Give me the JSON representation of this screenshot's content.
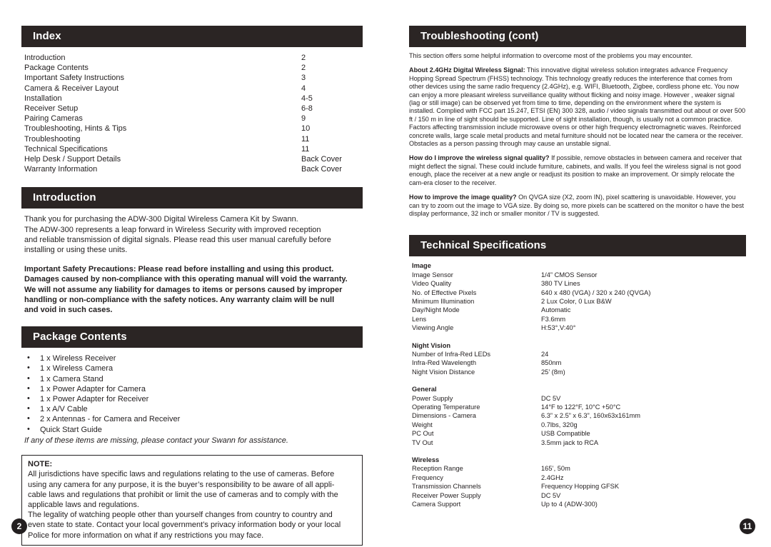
{
  "left_page": {
    "page_number": "2",
    "index": {
      "heading": "Index",
      "rows": [
        {
          "title": "Introduction",
          "page": "2"
        },
        {
          "title": "Package Contents",
          "page": "2"
        },
        {
          "title": "Important Safety Instructions",
          "page": "3"
        },
        {
          "title": "Camera & Receiver Layout",
          "page": "4"
        },
        {
          "title": "Installation",
          "page": "4-5"
        },
        {
          "title": "Receiver Setup",
          "page": "6-8"
        },
        {
          "title": "Pairing Cameras",
          "page": "9"
        },
        {
          "title": "Troubleshooting, Hints & Tips",
          "page": "10"
        },
        {
          "title": "Troubleshooting",
          "page": "11"
        },
        {
          "title": "Technical Specifications",
          "page": "11"
        },
        {
          "title": "Help Desk / Support Details",
          "page": "Back Cover"
        },
        {
          "title": "Warranty Information",
          "page": "Back Cover"
        }
      ]
    },
    "introduction": {
      "heading": "Introduction",
      "line1": "Thank you for purchasing the ADW-300 Digital Wireless Camera Kit by Swann.",
      "line2": "The ADW-300 represents a leap forward in Wireless Security with improved reception",
      "line3": "and reliable transmission of digital signals.  Please read this user manual carefully before",
      "line4": "installing or using these units.",
      "safety1": "Important Safety Precautions: Please read before installing and using this product.",
      "safety2": "Damages caused by non-compliance with this operating manual will void the warranty.",
      "safety3": "We will not assume any liability for damages to items or persons caused by improper",
      "safety4": "handling or non-compliance with the safety notices. Any warranty claim will be null",
      "safety5": "and void in such cases."
    },
    "package_contents": {
      "heading": "Package Contents",
      "items": [
        "1 x Wireless Receiver",
        "1 x Wireless Camera",
        "1 x Camera Stand",
        "1 x Power Adapter for Camera",
        "1 x Power Adapter for Receiver",
        "1 x A/V Cable",
        "2 x Antennas - for Camera and Receiver",
        "Quick Start Guide"
      ],
      "footnote": "If any of these items are missing, please contact your Swann for assistance."
    },
    "note_box": {
      "title": "NOTE:",
      "paragraph1_line1": "All jurisdictions have specific laws and regulations relating to the use of cameras. Before",
      "paragraph1_line2": "using any camera for any purpose, it is the buyer’s responsibility to be aware of all appli-",
      "paragraph1_line3": "cable laws and regulations that prohibit or limit the use of cameras and to comply with the",
      "paragraph1_line4": "applicable laws and regulations.",
      "paragraph2_line1": "The legality of watching people other than yourself changes from country to country and",
      "paragraph2_line2": "even state to state. Contact your local government’s privacy information body or your local",
      "paragraph2_line3": "Police for more information on what if any restrictions you may face."
    }
  },
  "right_page": {
    "page_number": "11",
    "troubleshooting": {
      "heading": "Troubleshooting (cont)",
      "intro": "This section offers some helpful information to overcome most of the problems you may encounter.",
      "p1_label": "About 2.4GHz Digital Wireless Signal:",
      "p1_body": " This innovative digital wireless solution integrates advance Frequency Hopping Spread Spectrum (FHSS) technology. This technology greatly reduces the interference that comes from other devices using the same radio frequency (2.4GHz), e.g. WIFI, Bluetooth, Zigbee, cordless phone etc. You now can enjoy a more pleasant wireless surveillance quality without flicking and noisy image. However , weaker signal (lag or still image) can be observed yet from time to time, depending on the environment where the system is installed. Complied with FCC part 15.247, ETSI (EN) 300 328, audio / video signals transmitted out about or over 500 ft / 150 m in line of sight should be supported. Line of sight installation, though, is usually not a common practice. Factors affecting transmission include microwave ovens or other high frequency electromagnetic waves. Reinforced concrete walls, large scale metal products and metal furniture should not be located near the camera or the receiver. Obstacles as a person passing through may cause an unstable signal.",
      "p2_label": "How do I improve the wireless signal quality?",
      "p2_body": " If possible, remove obstacles in between camera and receiver that might deflect the signal. These could include furniture, cabinets, and walls. If you feel the wireless signal is not good enough, place the receiver at a new angle or readjust its position to make an improvement. Or simply relocate the cam-era closer to the receiver.",
      "p3_label": "How to improve the image quality?",
      "p3_body": " On QVGA size (X2, zoom IN), pixel scattering is unavoidable. However, you can try to zoom out the image to VGA size. By doing so, more pixels can be scattered on the monitor o have the best display performance, 32 inch or smaller monitor / TV is suggested."
    },
    "technical_specifications": {
      "heading": "Technical Specifications",
      "groups": [
        {
          "name": "Image",
          "rows": [
            {
              "label": "Image Sensor",
              "value": "1/4” CMOS Sensor"
            },
            {
              "label": "Video Quality",
              "value": "380 TV Lines"
            },
            {
              "label": "No. of Effective Pixels",
              "value": "640 x 480 (VGA) / 320 x 240 (QVGA)"
            },
            {
              "label": "Minimum Illumination",
              "value": "2 Lux Color, 0 Lux B&W"
            },
            {
              "label": "Day/Night Mode",
              "value": "Automatic"
            },
            {
              "label": "Lens",
              "value": "F3.6mm"
            },
            {
              "label": "Viewing Angle",
              "value": "H:53°,V:40°"
            }
          ]
        },
        {
          "name": "Night Vision",
          "rows": [
            {
              "label": "Number of Infra-Red LEDs",
              "value": "24"
            },
            {
              "label": "Infra-Red Wavelength",
              "value": "850nm"
            },
            {
              "label": "Night Vision Distance",
              "value": "25’ (8m)"
            }
          ]
        },
        {
          "name": "General",
          "rows": [
            {
              "label": "Power Supply",
              "value": "DC 5V"
            },
            {
              "label": "Operating Temperature",
              "value": "14°F to 122°F, 10°C +50°C"
            },
            {
              "label": "Dimensions - Camera",
              "value": "6.3” x 2.5” x 6.3”, 160x63x161mm"
            },
            {
              "label": "Weight",
              "value": "0.7lbs, 320g"
            },
            {
              "label": "PC Out",
              "value": "USB Compatible"
            },
            {
              "label": "TV Out",
              "value": "3.5mm jack to RCA"
            }
          ]
        },
        {
          "name": "Wireless",
          "rows": [
            {
              "label": "Reception Range",
              "value": "165’, 50m"
            },
            {
              "label": "Frequency",
              "value": "2.4GHz"
            },
            {
              "label": "Transmission Channels",
              "value": "Frequency Hopping GFSK"
            },
            {
              "label": "Receiver Power Supply",
              "value": "DC 5V"
            },
            {
              "label": "Camera Support",
              "value": "Up to 4 (ADW-300)"
            }
          ]
        }
      ]
    }
  },
  "colors": {
    "header_bar": "#2b2524",
    "text": "#231f20",
    "page": "#ffffff"
  }
}
